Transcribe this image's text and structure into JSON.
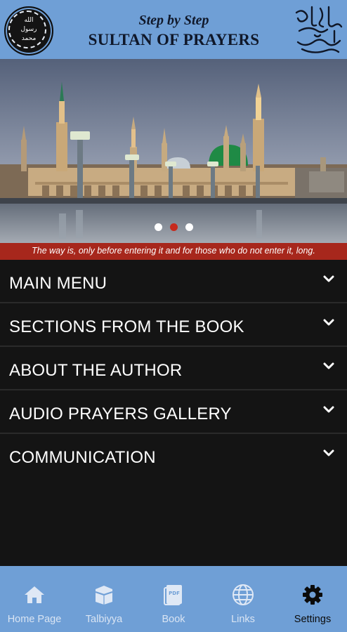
{
  "header": {
    "subtitle": "Step by Step",
    "title": "SULTAN OF PRAYERS",
    "seal_text": [
      "الله",
      "رسول",
      "محمد"
    ],
    "calligraphy_text": "صلى الله عليه وسلم"
  },
  "banner": {
    "caption": "The way is, only before entering it and for those who do not enter it, long.",
    "slides": 3,
    "active_slide": 2
  },
  "menu": {
    "items": [
      {
        "label": "MAIN MENU"
      },
      {
        "label": "SECTIONS FROM THE BOOK"
      },
      {
        "label": "ABOUT THE AUTHOR"
      },
      {
        "label": "AUDIO PRAYERS GALLERY"
      },
      {
        "label": "COMMUNICATION"
      }
    ]
  },
  "tabs": [
    {
      "label": "Home Page",
      "icon": "home-icon"
    },
    {
      "label": "Talbiyya",
      "icon": "kaaba-icon"
    },
    {
      "label": "Book",
      "icon": "pdf-icon"
    },
    {
      "label": "Links",
      "icon": "globe-icon"
    },
    {
      "label": "Settings",
      "icon": "gear-icon",
      "active": true
    }
  ],
  "colors": {
    "header_bg": "#6f9fd6",
    "caption_bg": "#a7271c",
    "menu_bg": "#141414",
    "active_dot": "#c62a1d"
  }
}
